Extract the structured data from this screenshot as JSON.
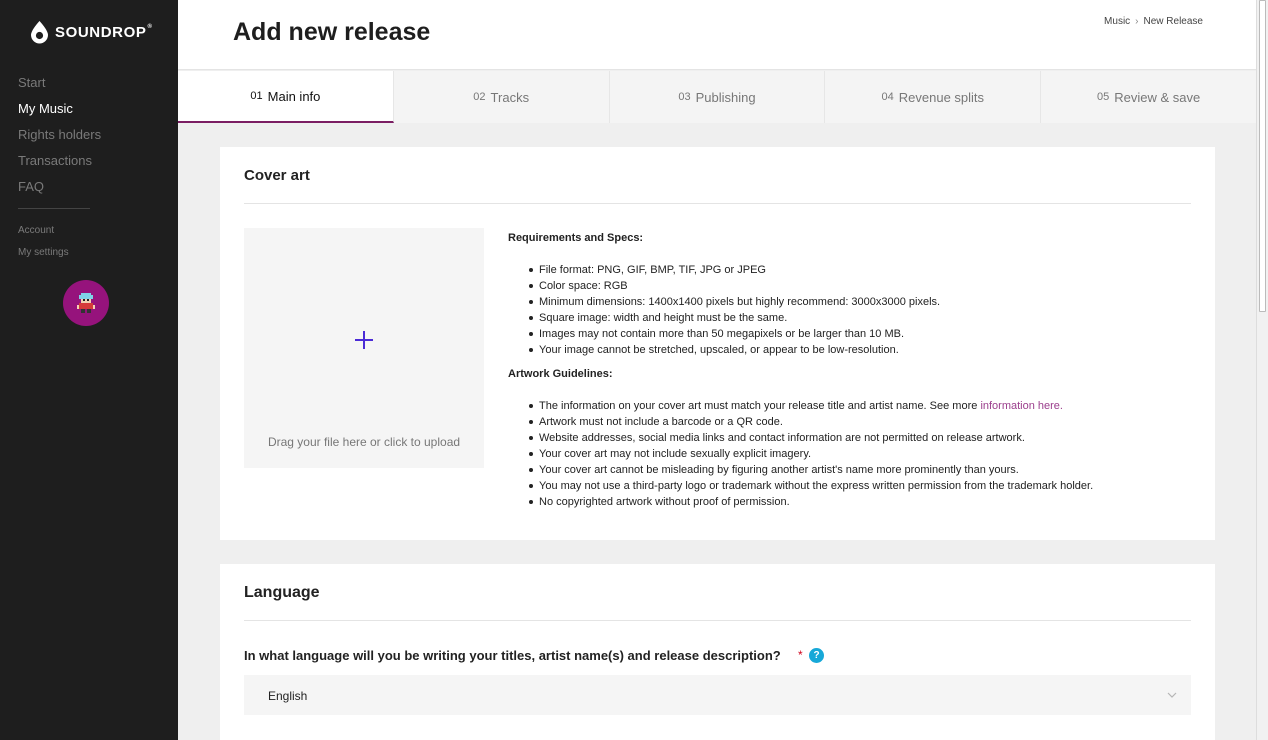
{
  "brand": {
    "name": "SOUNDROP",
    "mark": "®"
  },
  "sidebar": {
    "nav": [
      "Start",
      "My Music",
      "Rights holders",
      "Transactions",
      "FAQ"
    ],
    "active_index": 1,
    "sub_nav": [
      "Account",
      "My settings"
    ]
  },
  "header": {
    "title": "Add new release",
    "breadcrumb": [
      "Music",
      "New Release"
    ],
    "breadcrumb_separator": "›"
  },
  "tabs": [
    {
      "num": "01",
      "label": "Main info",
      "active": true
    },
    {
      "num": "02",
      "label": "Tracks",
      "active": false
    },
    {
      "num": "03",
      "label": "Publishing",
      "active": false
    },
    {
      "num": "04",
      "label": "Revenue splits",
      "active": false
    },
    {
      "num": "05",
      "label": "Review & save",
      "active": false
    }
  ],
  "cover_art": {
    "title": "Cover art",
    "upload_text": "Drag your file here or click to upload",
    "requirements_heading": "Requirements and Specs:",
    "requirements": [
      "File format: PNG, GIF, BMP, TIF, JPG or JPEG",
      "Color space: RGB",
      "Minimum dimensions: 1400x1400 pixels but highly recommend: 3000x3000 pixels.",
      "Square image: width and height must be the same.",
      "Images may not contain more than 50 megapixels or be larger than 10 MB.",
      "Your image cannot be stretched, upscaled, or appear to be low-resolution."
    ],
    "guidelines_heading": "Artwork Guidelines:",
    "guideline_first": "The information on your cover art must match your release title and artist name. See more",
    "guideline_link": "information here.",
    "guidelines": [
      "Artwork must not include a barcode or a QR code.",
      "Website addresses, social media links and contact information are not permitted on release artwork.",
      "Your cover art may not include sexually explicit imagery.",
      "Your cover art cannot be misleading by figuring another artist's name more prominently than yours.",
      "You may not use a third-party logo or trademark without the express written permission from the trademark holder.",
      "No copyrighted artwork without proof of permission."
    ]
  },
  "language": {
    "title": "Language",
    "question": "In what language will you be writing your titles, artist name(s) and release description?",
    "required_mark": "*",
    "help_glyph": "?",
    "selected": "English"
  },
  "colors": {
    "sidebar_bg": "#1e1e1e",
    "accent": "#7b1e63",
    "avatar_bg": "#96137c",
    "plus_icon": "#4b2bd6",
    "link": "#9b3e8c",
    "help": "#17a8d8"
  }
}
